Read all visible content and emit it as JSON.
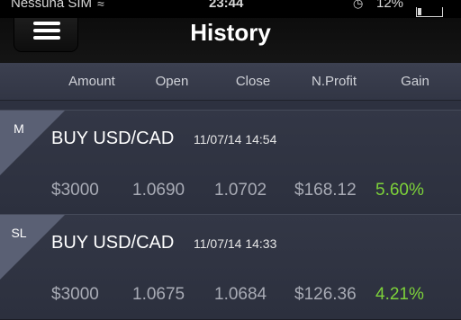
{
  "status_bar": {
    "carrier": "Nessuna SIM",
    "wifi_icon": "wifi-icon",
    "time": "23:44",
    "alarm_icon": "alarm-icon",
    "battery": "12%",
    "battery_level": 0.12
  },
  "nav": {
    "title": "History",
    "menu_icon": "hamburger-menu-icon"
  },
  "columns": [
    "Amount",
    "Open",
    "Close",
    "N.Profit",
    "Gain"
  ],
  "trades": [
    {
      "tag": "M",
      "title": "BUY USD/CAD",
      "datetime": "11/07/14 14:54",
      "amount": "$3000",
      "open": "1.0690",
      "close": "1.0702",
      "net_profit": "$168.12",
      "gain": "5.60%"
    },
    {
      "tag": "SL",
      "title": "BUY USD/CAD",
      "datetime": "11/07/14 14:33",
      "amount": "$3000",
      "open": "1.0675",
      "close": "1.0684",
      "net_profit": "$126.36",
      "gain": "4.21%"
    }
  ],
  "colors": {
    "background": "#2d3140",
    "nav_background": "#0f0f0f",
    "gain_positive": "#7dd23a",
    "value_text": "#a8abb5",
    "tag_background": "#5a6074"
  }
}
